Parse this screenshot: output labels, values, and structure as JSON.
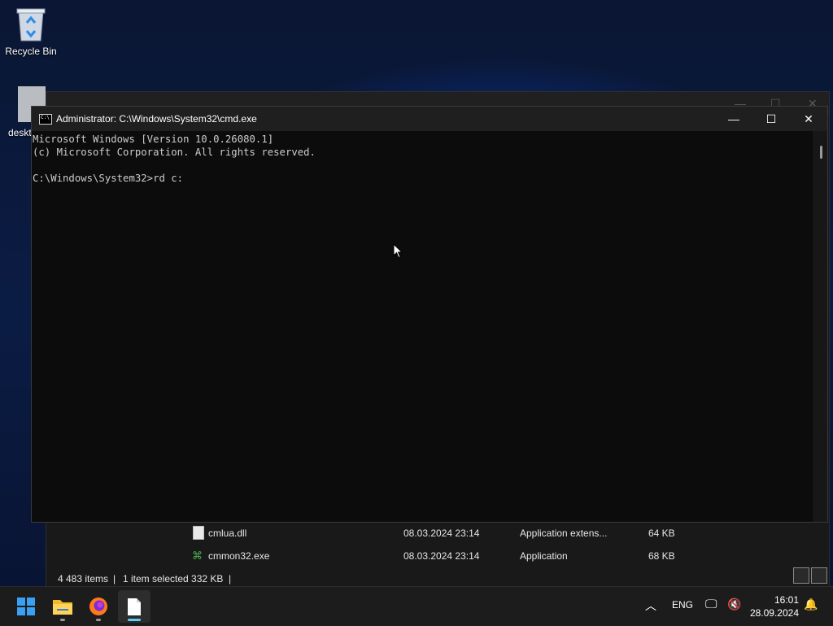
{
  "desktop": {
    "recycle_bin_label": "Recycle Bin",
    "desktop_file_label": "deskt"
  },
  "explorer": {
    "files": [
      {
        "name": "cmlua.dll",
        "date": "08.03.2024 23:14",
        "type": "Application extens...",
        "size": "64 KB"
      },
      {
        "name": "cmmon32.exe",
        "date": "08.03.2024 23:14",
        "type": "Application",
        "size": "68 KB"
      }
    ],
    "status": {
      "item_count": "4 483 items",
      "selection": "1 item selected  332 KB"
    }
  },
  "cmd": {
    "title": "Administrator: C:\\Windows\\System32\\cmd.exe",
    "minimize_glyph": "—",
    "maximize_glyph": "☐",
    "close_glyph": "✕",
    "console_text": "Microsoft Windows [Version 10.0.26080.1]\n(c) Microsoft Corporation. All rights reserved.\n\nC:\\Windows\\System32>rd c:"
  },
  "taskbar": {
    "apps": [
      {
        "name": "start-button",
        "icon": "windows-logo-icon"
      },
      {
        "name": "file-explorer",
        "icon": "folder-icon"
      },
      {
        "name": "firefox",
        "icon": "firefox-icon"
      },
      {
        "name": "cmd-window",
        "icon": "document-icon"
      }
    ],
    "language": "ENG",
    "time": "16:01",
    "date": "28.09.2024"
  },
  "colors": {
    "accent": "#0078d4",
    "console_bg": "#0c0c0c",
    "console_text": "#cccccc",
    "taskbar_bg": "#1c1c1c"
  }
}
